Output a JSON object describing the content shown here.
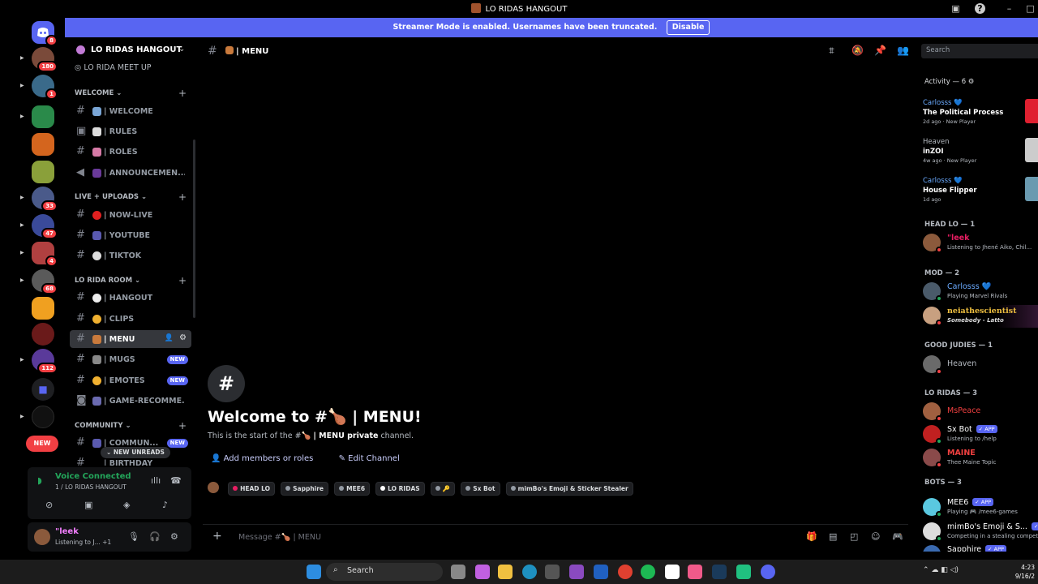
{
  "window": {
    "title": "LO RIDAS HANGOUT"
  },
  "streamer_banner": {
    "text": "Streamer Mode is enabled. Usernames have been truncated.",
    "button": "Disable"
  },
  "servers": {
    "badges": [
      "8",
      "180",
      "1",
      "",
      "",
      "",
      "33",
      "47",
      "4",
      "68",
      "",
      "",
      "112"
    ],
    "new_pill": "NEW"
  },
  "guild": {
    "name": "LO RIDAS HANGOUT",
    "meetup": "LO RIDA MEET UP",
    "categories": {
      "welcome": "WELCOME",
      "live": "LIVE + UPLOADS",
      "room": "LO RIDA ROOM",
      "community": "COMMUNITY"
    },
    "channels": {
      "welcome": "| WELCOME",
      "rules": "| RULES",
      "roles": "| ROLES",
      "announcements": "| ANNOUNCEMEN...",
      "nowlive": "| NOW-LIVE",
      "youtube": "| YOUTUBE",
      "tiktok": "| TIKTOK",
      "hangout": "| HANGOUT",
      "clips": "| CLIPS",
      "menu": "| MENU",
      "mugs": "| MUGS",
      "emotes": "| EMOTES",
      "gamerec": "| GAME-RECOMME...",
      "commun": "| COMMUN...",
      "birthday": "| BIRTHDAY"
    },
    "new_tag": "NEW",
    "new_unreads": "NEW UNREADS"
  },
  "voice": {
    "title": "Voice Connected",
    "sub": "1 / LO RIDAS HANGOUT"
  },
  "user": {
    "name": "\"leek",
    "status": "Listening to J...  +1"
  },
  "channel": {
    "header": "| MENU",
    "welcome_title": "Welcome to #🍗 | MENU!",
    "welcome_sub_pre": "This is the start of the #🍗 ",
    "welcome_sub_bold": "| MENU private",
    "welcome_sub_post": " channel.",
    "add_members": "Add members or roles",
    "edit_channel": "Edit Channel",
    "roles": [
      "HEAD LO",
      "Sapphire",
      "MEE6",
      "LO RIDAS",
      "🔑",
      "Sx Bot",
      "mimBo's Emoji & Sticker Stealer"
    ],
    "role_colors": [
      "#e91e63",
      "#949ba4",
      "#949ba4",
      "#ffffff",
      "#949ba4",
      "#949ba4",
      "#949ba4"
    ],
    "composer_placeholder": "Message #🍗 | MENU"
  },
  "members": {
    "search_placeholder": "Search",
    "activity_header": "Activity — 6 ⚙",
    "activities": [
      {
        "name": "Carlosss 💙",
        "game": "The Political Process",
        "meta": "2d ago · New Player"
      },
      {
        "name": "Heaven",
        "game": "inZOI",
        "meta": "4w ago · New Player"
      },
      {
        "name": "Carlosss 💙",
        "game": "House Flipper",
        "meta": "1d ago"
      }
    ],
    "sections": {
      "head": "HEAD LO — 1",
      "mod": "MOD — 2",
      "judies": "GOOD JUDIES — 1",
      "loridas": "LO RIDAS — 3",
      "bots": "BOTS — 3"
    },
    "list": {
      "leek": {
        "name": "\"leek",
        "sub": "Listening to Jhené Aiko, Chil..."
      },
      "carlosss": {
        "name": "Carlosss 💙",
        "sub": "Playing Marvel Rivals"
      },
      "neia": {
        "name": "neiathescientist",
        "sub": "Somebody - Latto"
      },
      "heaven": {
        "name": "Heaven",
        "sub": ""
      },
      "mspeace": {
        "name": "MsPeace",
        "sub": ""
      },
      "sxbot": {
        "name": "Sx Bot",
        "sub": "Listening to /help"
      },
      "maine": {
        "name": "MAINE",
        "sub": "Thee Maine Topic"
      },
      "mee6": {
        "name": "MEE6",
        "sub": "Playing 🎮 /mee6-games"
      },
      "mimbo": {
        "name": "mimBo's Emoji & S...",
        "sub": "Competing in a stealing competi..."
      },
      "sapphire": {
        "name": "Sapphire",
        "sub": ""
      }
    },
    "app_tag": "✓ APP"
  },
  "taskbar": {
    "search": "Search",
    "time": "4:23",
    "date": "9/16/2"
  }
}
